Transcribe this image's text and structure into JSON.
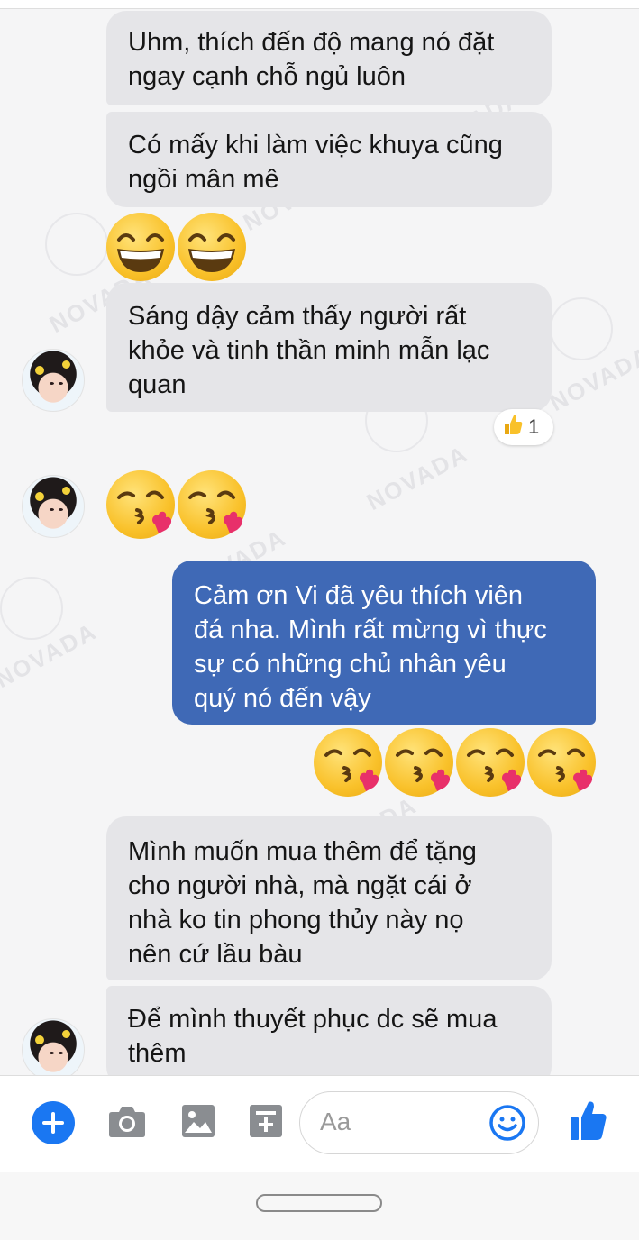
{
  "messages": [
    {
      "side": "in",
      "lines": [
        "Uhm, thích đến độ mang nó đặt",
        "ngay cạnh chỗ ngủ luôn"
      ]
    },
    {
      "side": "in",
      "lines": [
        "Có mấy khi làm việc khuya cũng",
        "ngồi mân mê"
      ]
    },
    {
      "side": "in",
      "lines": [
        "Sáng dậy cảm thấy người rất",
        "khỏe và tinh thần minh mẫn lạc",
        "quan"
      ]
    },
    {
      "side": "out",
      "lines": [
        "Cảm ơn Vi đã yêu thích viên",
        "đá nha. Mình rất mừng vì thực",
        "sự có những chủ nhân yêu",
        "quý nó đến vậy"
      ]
    },
    {
      "side": "in",
      "lines": [
        "Mình muốn mua thêm để tặng",
        "cho người nhà, mà ngặt cái ở",
        "nhà ko tin phong thủy này nọ",
        "nên cứ lầu bàu"
      ]
    },
    {
      "side": "in",
      "lines": [
        "Để mình thuyết phục dc sẽ mua",
        "thêm"
      ]
    }
  ],
  "reaction": {
    "emoji": "thumbs-up",
    "count": "1"
  },
  "emoji_rows": [
    {
      "type": "grinning-emoji",
      "count": 2
    },
    {
      "type": "kissing-heart-emoji",
      "count": 2
    },
    {
      "type": "kissing-heart-emoji",
      "count": 4
    }
  ],
  "watermark": {
    "text": "NOVADA"
  },
  "composer": {
    "placeholder": "Aa",
    "icons": [
      "plus-icon",
      "camera-icon",
      "image-icon",
      "gif-sticker-icon",
      "smiley-icon",
      "like-icon"
    ]
  },
  "colors": {
    "incoming_bubble": "#e5e5e8",
    "outgoing_bubble": "#3f69b6",
    "accent": "#1a77f2"
  }
}
